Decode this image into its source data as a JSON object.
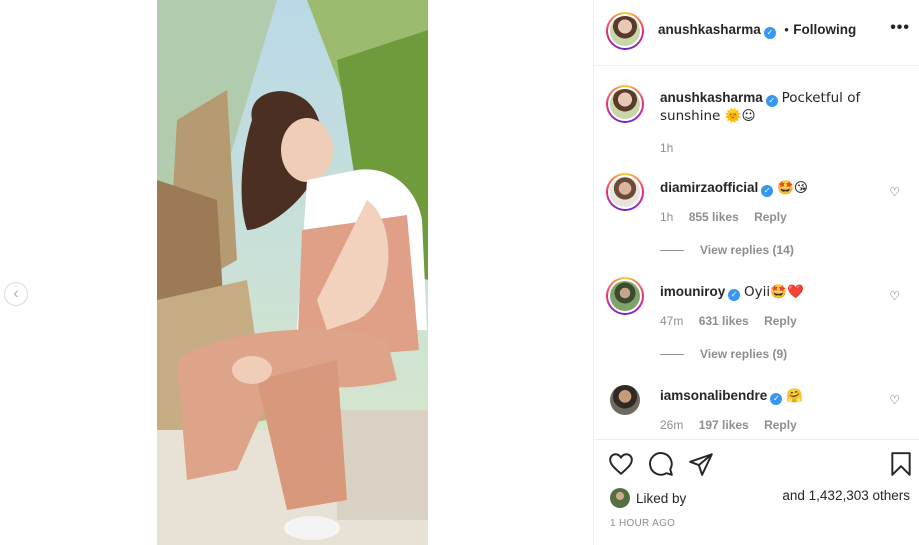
{
  "header": {
    "username": "anushkasharma",
    "separator": "•",
    "follow_status": "Following",
    "more": "•••"
  },
  "caption": {
    "username": "anushkasharma",
    "text": "Pocketful of sunshine 🌞☺",
    "time": "1h"
  },
  "comments": [
    {
      "username": "diamirzaofficial",
      "text": "🤩😘",
      "time": "1h",
      "likes": "855 likes",
      "reply": "Reply",
      "view_replies": "View replies (14)"
    },
    {
      "username": "imouniroy",
      "text": "Oyii🤩❤️",
      "time": "47m",
      "likes": "631 likes",
      "reply": "Reply",
      "view_replies": "View replies (9)"
    },
    {
      "username": "iamsonalibendre",
      "text": "🤗",
      "time": "26m",
      "likes": "197 likes",
      "reply": "Reply"
    }
  ],
  "likes": {
    "liked_by": "Liked by",
    "others": "and 1,432,303 others"
  },
  "timestamp": "1 HOUR AGO",
  "icons": {
    "prev": "chevron-left-icon",
    "verified": "verified-badge-icon",
    "like": "heart-icon",
    "comment": "comment-icon",
    "share": "share-icon",
    "save": "bookmark-icon"
  },
  "colors": {
    "verified": "#3897f0",
    "muted": "#8e8e8e",
    "text": "#262626"
  }
}
